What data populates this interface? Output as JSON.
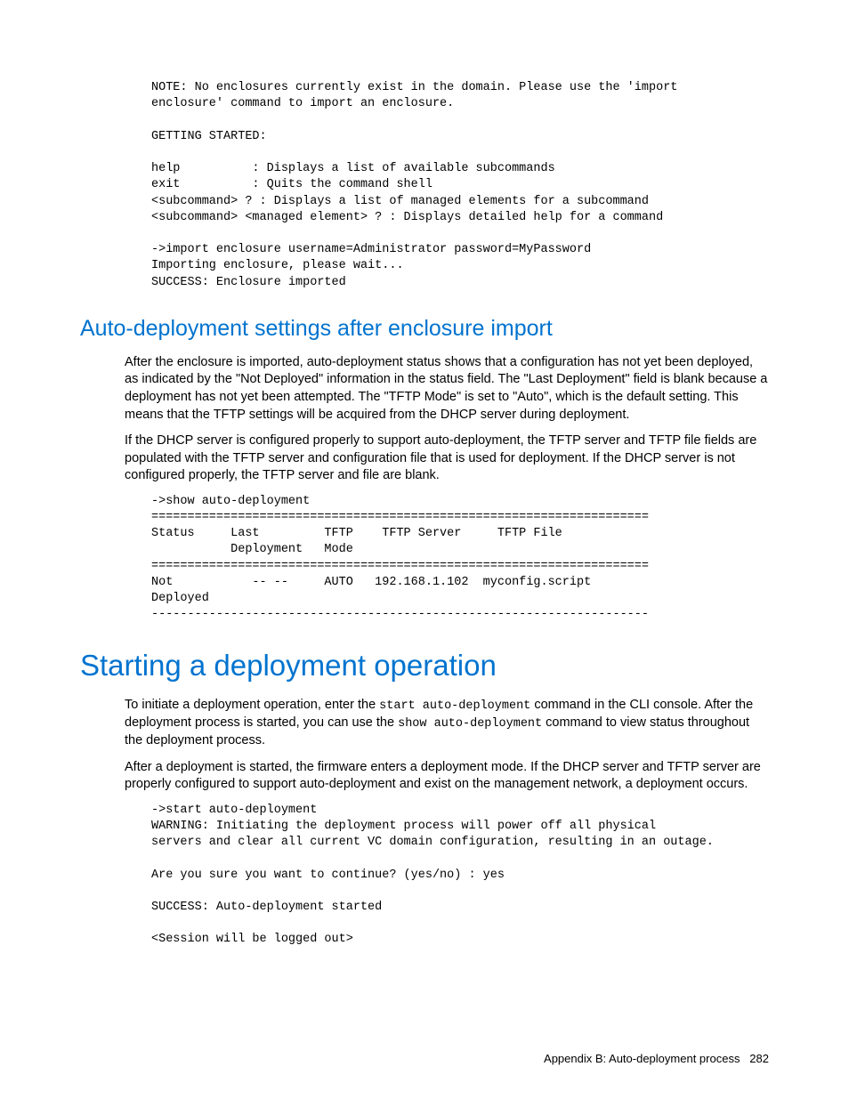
{
  "codeblock1": "NOTE: No enclosures currently exist in the domain. Please use the 'import\nenclosure' command to import an enclosure.\n\nGETTING STARTED:\n\nhelp          : Displays a list of available subcommands\nexit          : Quits the command shell\n<subcommand> ? : Displays a list of managed elements for a subcommand\n<subcommand> <managed element> ? : Displays detailed help for a command\n\n->import enclosure username=Administrator password=MyPassword\nImporting enclosure, please wait...\nSUCCESS: Enclosure imported",
  "section1": {
    "title": "Auto-deployment settings after enclosure import",
    "para1": "After the enclosure is imported, auto-deployment status shows that a configuration has not yet been deployed, as indicated by the \"Not Deployed\" information in the status field. The \"Last Deployment\" field is blank because a deployment has not yet been attempted. The \"TFTP Mode\" is set to \"Auto\", which is the default setting. This means that the TFTP settings will be acquired from the DHCP server during deployment.",
    "para2": "If the DHCP server is configured properly to support auto-deployment, the TFTP server and TFTP file fields are populated with the TFTP server and configuration file that is used for deployment. If the DHCP server is not configured properly, the TFTP server and file are blank."
  },
  "codeblock2": "->show auto-deployment\n=====================================================================\nStatus     Last         TFTP    TFTP Server     TFTP File\n           Deployment   Mode\n=====================================================================\nNot           -- --     AUTO   192.168.1.102  myconfig.script\nDeployed\n---------------------------------------------------------------------",
  "section2": {
    "title": "Starting a deployment operation",
    "para1_a": "To initiate a deployment operation, enter the ",
    "para1_cmd1": "start auto-deployment",
    "para1_b": " command in the CLI console. After the deployment process is started, you can use the ",
    "para1_cmd2": "show auto-deployment",
    "para1_c": " command to view status throughout the deployment process.",
    "para2": "After a deployment is started, the firmware enters a deployment mode. If the DHCP server and TFTP server are properly configured to support auto-deployment and exist on the management network, a deployment occurs."
  },
  "codeblock3": "->start auto-deployment\nWARNING: Initiating the deployment process will power off all physical\nservers and clear all current VC domain configuration, resulting in an outage.\n\nAre you sure you want to continue? (yes/no) : yes\n\nSUCCESS: Auto-deployment started\n\n<Session will be logged out>",
  "footer": {
    "label": "Appendix B: Auto-deployment process",
    "page": "282"
  }
}
